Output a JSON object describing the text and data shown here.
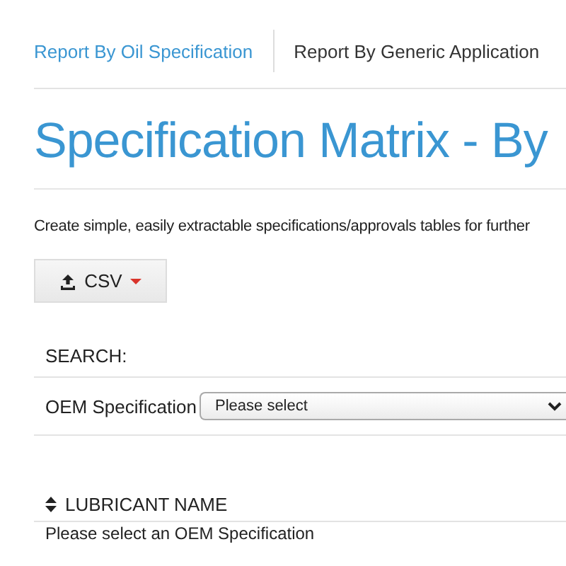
{
  "tabs": [
    {
      "label": "Report By Oil Specification",
      "selected": true
    },
    {
      "label": "Report By Generic Application",
      "selected": false
    }
  ],
  "title": "Specification Matrix - By",
  "description": "Create simple, easily extractable specifications/approvals tables for further",
  "export_button": {
    "label": "CSV"
  },
  "search": {
    "heading": "SEARCH:",
    "field_label": "OEM Specification",
    "placeholder": "Please select"
  },
  "table": {
    "column": "LUBRICANT NAME",
    "empty_message": "Please select an OEM Specification"
  }
}
